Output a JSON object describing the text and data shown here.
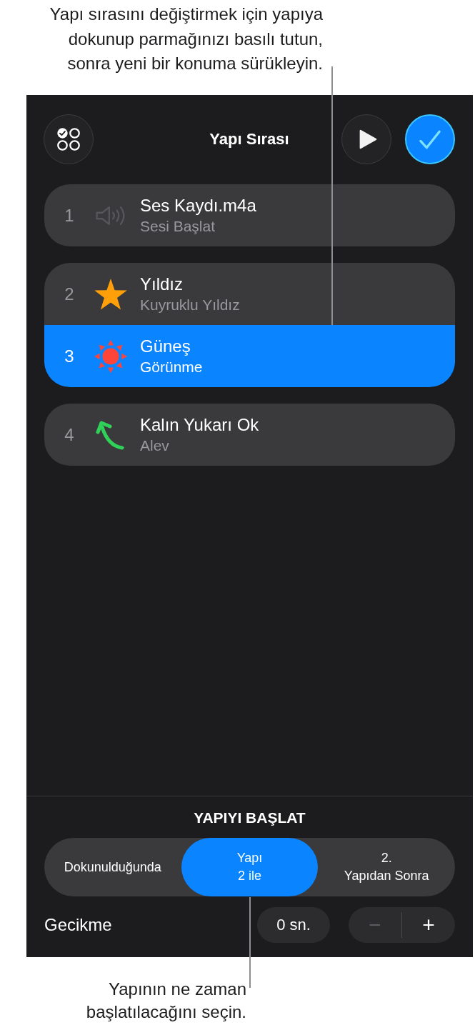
{
  "top_callout": {
    "text": "Yapı sırasını değiştirmek için yapıya\ndokunup parmağınızı basılı tutun,\nsonra yeni bir konuma sürükleyin."
  },
  "header": {
    "title": "Yapı Sırası"
  },
  "build_groups": [
    {
      "builds": [
        {
          "number": "1",
          "kind": "audio",
          "title": "Ses Kaydı.m4a",
          "subtitle": "Sesi Başlat",
          "selected": false
        }
      ]
    },
    {
      "builds": [
        {
          "number": "2",
          "kind": "star",
          "title": "Yıldız",
          "subtitle": "Kuyruklu Yıldız",
          "selected": false
        },
        {
          "number": "3",
          "kind": "sun",
          "title": "Güneş",
          "subtitle": "Görünme",
          "selected": true
        }
      ]
    },
    {
      "builds": [
        {
          "number": "4",
          "kind": "arrow",
          "title": "Kalın Yukarı Ok",
          "subtitle": "Alev",
          "selected": false
        }
      ]
    }
  ],
  "start": {
    "heading": "YAPIYI BAŞLAT",
    "options": [
      {
        "label": "Dokunulduğunda",
        "selected": false
      },
      {
        "label": "Yapı\n2 ile",
        "selected": true
      },
      {
        "label": "2.\nYapıdan Sonra",
        "selected": false
      }
    ]
  },
  "delay": {
    "label": "Gecikme",
    "value": "0 sn.",
    "decrement": {
      "label": "−",
      "disabled": true
    },
    "increment": {
      "label": "+",
      "disabled": false
    }
  },
  "bottom_callout": {
    "text": "Yapının ne zaman\nbaşlatılacağını seçin."
  }
}
